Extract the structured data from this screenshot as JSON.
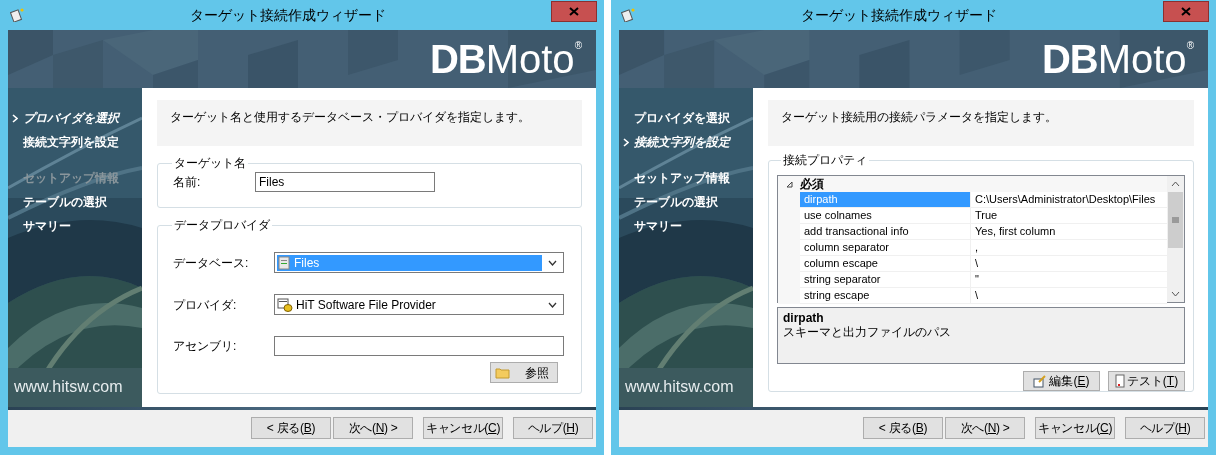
{
  "windows": [
    {
      "title": "ターゲット接続作成ウィザード",
      "logo": {
        "bold": "DB",
        "light": "Moto",
        "mark": "®"
      },
      "website": "www.hitsw.com",
      "step_groups": [
        {
          "steps": [
            {
              "label": "プロバイダを選択",
              "selected": true,
              "disabled": false
            },
            {
              "label": "接続文字列を設定",
              "selected": false,
              "disabled": false
            }
          ]
        },
        {
          "steps": [
            {
              "label": "セットアップ情報",
              "selected": false,
              "disabled": true
            },
            {
              "label": "テーブルの選択",
              "selected": false,
              "disabled": false
            },
            {
              "label": "サマリー",
              "selected": false,
              "disabled": false
            }
          ]
        }
      ],
      "page": {
        "kind": "provider",
        "description": "ターゲット名と使用するデータベース・プロバイダを指定します。",
        "groups": [
          {
            "title": "ターゲット名",
            "fields": [
              {
                "kind": "text",
                "label": "名前:",
                "value": "Files"
              }
            ]
          },
          {
            "title": "データプロバイダ",
            "fields": [
              {
                "kind": "select",
                "label": "データベース:",
                "value": "Files",
                "selected": true
              },
              {
                "kind": "select",
                "label": "プロバイダ:",
                "value": "HiT Software File Provider",
                "selected": false
              },
              {
                "kind": "text",
                "label": "アセンブリ:"
              }
            ],
            "browse_button": "参照"
          }
        ]
      },
      "buttons": [
        {
          "prefix": "< 戻る(",
          "mnemonic": "B",
          "suffix": ")"
        },
        {
          "prefix": "次へ(",
          "mnemonic": "N",
          "suffix": ") >"
        },
        {
          "prefix": "キャンセル(",
          "mnemonic": "C",
          "suffix": ")"
        },
        {
          "prefix": "ヘルプ(",
          "mnemonic": "H",
          "suffix": ")"
        }
      ]
    },
    {
      "title": "ターゲット接続作成ウィザード",
      "logo": {
        "bold": "DB",
        "light": "Moto",
        "mark": "®"
      },
      "website": "www.hitsw.com",
      "step_groups": [
        {
          "steps": [
            {
              "label": "プロバイダを選択",
              "selected": false,
              "disabled": false
            },
            {
              "label": "接続文字列を設定",
              "selected": true,
              "disabled": false
            }
          ]
        },
        {
          "steps": [
            {
              "label": "セットアップ情報",
              "selected": false,
              "disabled": false
            },
            {
              "label": "テーブルの選択",
              "selected": false,
              "disabled": false
            },
            {
              "label": "サマリー",
              "selected": false,
              "disabled": false
            }
          ]
        }
      ],
      "page": {
        "kind": "connection",
        "description": "ターゲット接続用の接続パラメータを指定します。",
        "group": {
          "title": "接続プロパティ",
          "category": {
            "label": "必須",
            "expanded": true
          },
          "properties": [
            {
              "name": "dirpath",
              "value": "C:\\Users\\Administrator\\Desktop\\Files",
              "selected": true
            },
            {
              "name": "use colnames",
              "value": "True",
              "selected": false
            },
            {
              "name": "add transactional info",
              "value": "Yes, first column",
              "selected": false
            },
            {
              "name": "column separator",
              "value": ",",
              "selected": false
            },
            {
              "name": "column escape",
              "value": "\\",
              "selected": false
            },
            {
              "name": "string separator",
              "value": "\"",
              "selected": false
            },
            {
              "name": "string escape",
              "value": "\\",
              "selected": false
            }
          ],
          "help": {
            "title": "dirpath",
            "text": "スキーマと出力ファイルのパス"
          },
          "buttons": [
            {
              "kind": "edit",
              "prefix": "編集(",
              "mnemonic": "E",
              "suffix": ")"
            },
            {
              "kind": "test",
              "prefix": "テスト(",
              "mnemonic": "T",
              "suffix": ")"
            }
          ]
        }
      },
      "buttons": [
        {
          "prefix": "< 戻る(",
          "mnemonic": "B",
          "suffix": ")"
        },
        {
          "prefix": "次へ(",
          "mnemonic": "N",
          "suffix": ") >"
        },
        {
          "prefix": "キャンセル(",
          "mnemonic": "C",
          "suffix": ")"
        },
        {
          "prefix": "ヘルプ(",
          "mnemonic": "H",
          "suffix": ")"
        }
      ]
    }
  ]
}
